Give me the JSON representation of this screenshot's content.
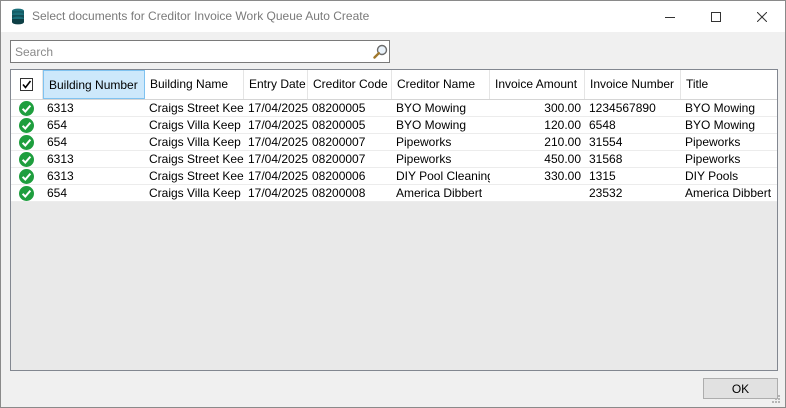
{
  "window": {
    "title": "Select documents for Creditor Invoice Work Queue Auto Create",
    "icon": "database-stack-icon"
  },
  "search": {
    "value": "",
    "placeholder": "Search"
  },
  "grid": {
    "columns": [
      "Building Number",
      "Building Name",
      "Entry Date",
      "Creditor Code",
      "Creditor Name",
      "Invoice Amount",
      "Invoice Number",
      "Title"
    ],
    "active_column": "Building Number",
    "select_all_checked": true,
    "rows": [
      {
        "checked": true,
        "cells": [
          "6313",
          "Craigs Street Keep",
          "17/04/2025",
          "08200005",
          "BYO Mowing",
          "300.00",
          "1234567890",
          "BYO Mowing"
        ]
      },
      {
        "checked": true,
        "cells": [
          "654",
          "Craigs Villa Keep",
          "17/04/2025",
          "08200005",
          "BYO Mowing",
          "120.00",
          "6548",
          "BYO Mowing"
        ]
      },
      {
        "checked": true,
        "cells": [
          "654",
          "Craigs Villa Keep",
          "17/04/2025",
          "08200007",
          "Pipeworks",
          "210.00",
          "31554",
          "Pipeworks"
        ]
      },
      {
        "checked": true,
        "cells": [
          "6313",
          "Craigs Street Keep",
          "17/04/2025",
          "08200007",
          "Pipeworks",
          "450.00",
          "31568",
          "Pipeworks"
        ]
      },
      {
        "checked": true,
        "cells": [
          "6313",
          "Craigs Street Keep",
          "17/04/2025",
          "08200006",
          "DIY Pool Cleaning",
          "330.00",
          "1315",
          "DIY Pools"
        ]
      },
      {
        "checked": true,
        "cells": [
          "654",
          "Craigs Villa Keep",
          "17/04/2025",
          "08200008",
          "America Dibbert",
          "",
          "23532",
          "America Dibbert"
        ]
      }
    ]
  },
  "footer": {
    "ok_label": "OK"
  },
  "colors": {
    "check_green": "#1e9e3e",
    "header_active": "#cde8fb",
    "grid_empty": "#e9e9e9"
  }
}
